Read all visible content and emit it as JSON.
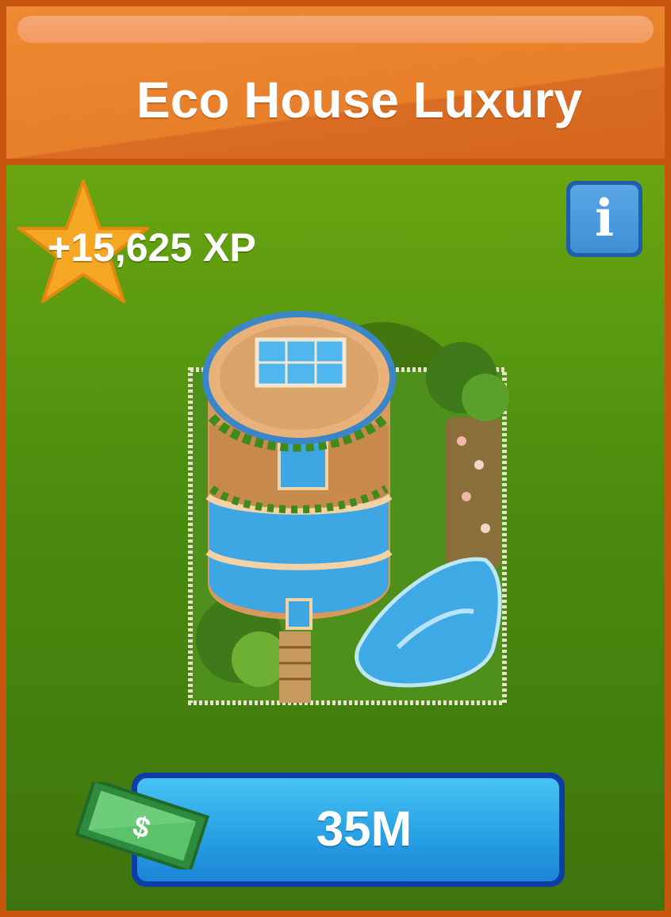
{
  "header": {
    "title": "Eco House Luxury"
  },
  "reward": {
    "xp_label": "+15,625 XP",
    "icon": "star-icon"
  },
  "info_button": {
    "label": "i",
    "icon": "info-icon"
  },
  "building": {
    "image": "eco-house-luxury-building"
  },
  "purchase": {
    "price": "35M",
    "currency_icon": "cash-icon",
    "currency_symbol": "$"
  },
  "colors": {
    "header": "#e87f2a",
    "panel": "#4b8c0f",
    "button": "#2ba4e6",
    "star": "#f5a623"
  }
}
